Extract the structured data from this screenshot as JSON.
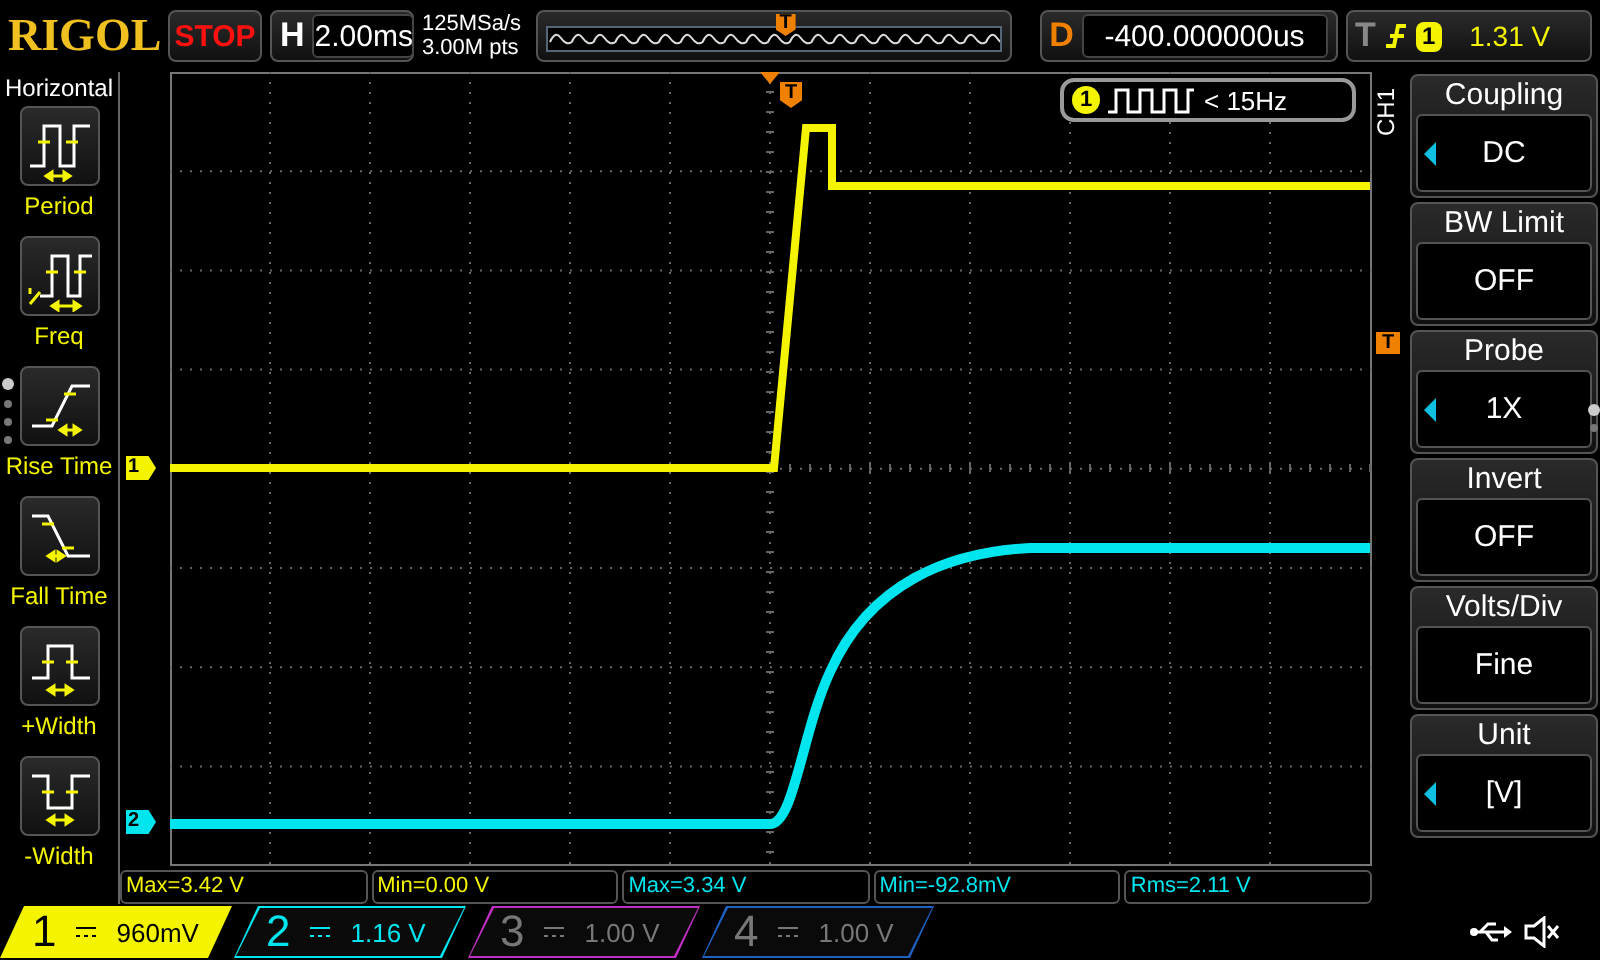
{
  "header": {
    "logo": "RIGOL",
    "run_state": "STOP",
    "timebase_label": "H",
    "timebase": "2.00ms",
    "sample_rate": "125MSa/s",
    "memory_depth": "3.00M pts",
    "trigger_marker": "T",
    "delay_label": "D",
    "delay": "-400.000000us",
    "trigger_label": "T",
    "trigger_source": "1",
    "trigger_level": "1.31 V"
  },
  "measure_menu": {
    "title": "Horizontal",
    "items": [
      {
        "label": "Period",
        "kind": "period"
      },
      {
        "label": "Freq",
        "kind": "freq"
      },
      {
        "label": "Rise Time",
        "kind": "rise"
      },
      {
        "label": "Fall Time",
        "kind": "fall"
      },
      {
        "label": "+Width",
        "kind": "pwidth"
      },
      {
        "label": "-Width",
        "kind": "nwidth"
      }
    ]
  },
  "plot": {
    "trigger_marker": "T",
    "trigger_level_marker": "T",
    "traces": [
      {
        "marker": "1",
        "color": "#f4f400"
      },
      {
        "marker": "2",
        "color": "#00e5ee"
      }
    ],
    "frequency_counter": {
      "source": "1",
      "reading": "< 15Hz"
    }
  },
  "channel_menu": {
    "title": "CH1",
    "items": [
      {
        "label": "Coupling",
        "value": "DC",
        "adjustable": true
      },
      {
        "label": "BW Limit",
        "value": "OFF",
        "adjustable": false
      },
      {
        "label": "Probe",
        "value": "1X",
        "adjustable": true
      },
      {
        "label": "Invert",
        "value": "OFF",
        "adjustable": false
      },
      {
        "label": "Volts/Div",
        "value": "Fine",
        "adjustable": false
      },
      {
        "label": "Unit",
        "value": "[V]",
        "adjustable": true
      }
    ]
  },
  "measurements": [
    {
      "text": "Max=3.42 V",
      "color": "#f4f400"
    },
    {
      "text": "Min=0.00 V",
      "color": "#f4f400"
    },
    {
      "text": "Max=3.34 V",
      "color": "#00e5ee"
    },
    {
      "text": "Min=-92.8mV",
      "color": "#00e5ee"
    },
    {
      "text": "Rms=2.11 V",
      "color": "#00e5ee"
    }
  ],
  "channels": [
    {
      "number": "1",
      "scale": "960mV",
      "color": "#f4f400",
      "on": true,
      "selected": true
    },
    {
      "number": "2",
      "scale": "1.16 V",
      "color": "#00e5ee",
      "on": true,
      "selected": false
    },
    {
      "number": "3",
      "scale": "1.00 V",
      "color": "#c030c0",
      "on": false,
      "selected": false
    },
    {
      "number": "4",
      "scale": "1.00 V",
      "color": "#2060c0",
      "on": false,
      "selected": false
    }
  ]
}
